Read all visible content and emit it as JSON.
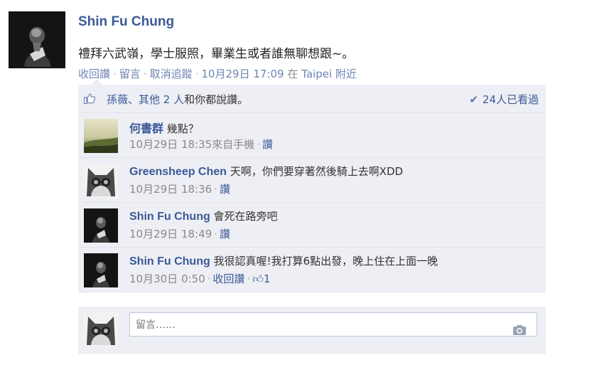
{
  "post": {
    "author": "Shin Fu Chung",
    "text": "禮拜六武嶺，學士服照，畢業生或者誰無聊想跟~。",
    "meta": {
      "unlike": "收回讚",
      "comment": "留言",
      "unfollow": "取消追蹤",
      "timestamp": "10月29日 17:09",
      "location_prefix": "在",
      "location": "Taipei 附近"
    }
  },
  "likes": {
    "text_prefix": "孫薇、其他 2 人",
    "text_suffix": "和你都說讚。",
    "seen": "24人已看過"
  },
  "comments": [
    {
      "author": "何書群",
      "text": "幾點？",
      "time": "10月29日 18:35",
      "source": "來自手機",
      "action": "讚",
      "like_count": ""
    },
    {
      "author": "Greensheep Chen",
      "text": "天啊，你們要穿著然後騎上去啊XDD",
      "time": "10月29日 18:36",
      "source": "",
      "action": "讚",
      "like_count": ""
    },
    {
      "author": "Shin Fu Chung",
      "text": "會死在路旁吧",
      "time": "10月29日 18:49",
      "source": "",
      "action": "讚",
      "like_count": ""
    },
    {
      "author": "Shin Fu Chung",
      "text": "我很認真喔!我打算6點出發，晚上住在上面一晚",
      "time": "10月30日 0:50",
      "source": "",
      "action": "收回讚",
      "like_count": "1"
    }
  ],
  "composer": {
    "placeholder": "留言……"
  },
  "colors": {
    "link": "#3b5998",
    "panel": "#edeff4",
    "meta": "#8a8a8a"
  }
}
